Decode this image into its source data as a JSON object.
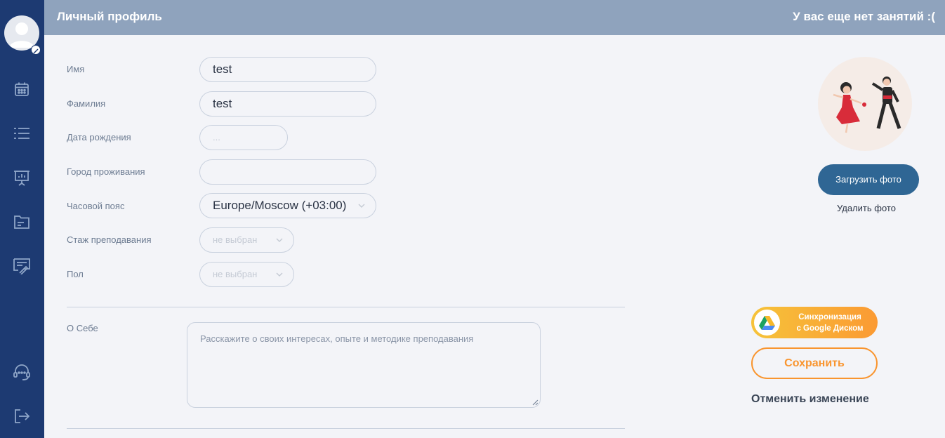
{
  "header": {
    "title": "Личный профиль",
    "status": "У вас еще нет занятий :("
  },
  "sidebar": {
    "items": [
      {
        "icon": "calendar-icon"
      },
      {
        "icon": "list-icon"
      },
      {
        "icon": "presentation-icon"
      },
      {
        "icon": "folder-icon"
      },
      {
        "icon": "certificate-icon"
      },
      {
        "icon": "support-headset-icon"
      },
      {
        "icon": "logout-icon"
      }
    ]
  },
  "form": {
    "first_name": {
      "label": "Имя",
      "value": "test"
    },
    "last_name": {
      "label": "Фамилия",
      "value": "test"
    },
    "birth_date": {
      "label": "Дата рождения",
      "placeholder": "..."
    },
    "city": {
      "label": "Город проживания",
      "value": ""
    },
    "timezone": {
      "label": "Часовой пояс",
      "value": "Europe/Moscow (+03:00)"
    },
    "experience": {
      "label": "Стаж преподавания",
      "placeholder": "не выбран"
    },
    "gender": {
      "label": "Пол",
      "placeholder": "не выбран"
    },
    "about": {
      "label": "О Себе",
      "placeholder": "Расскажите о своих интересах, опыте и методике преподавания"
    }
  },
  "photo": {
    "upload_label": "Загрузить фото",
    "delete_label": "Удалить фото"
  },
  "actions": {
    "gdrive_line1": "Синхронизация",
    "gdrive_line2": "с Google Диском",
    "save_label": "Сохранить",
    "cancel_label": "Отменить изменение"
  },
  "colors": {
    "sidebar": "#1d3a72",
    "header": "#8fa3bd",
    "primary_button": "#2f6694",
    "accent_orange": "#f9952f"
  }
}
